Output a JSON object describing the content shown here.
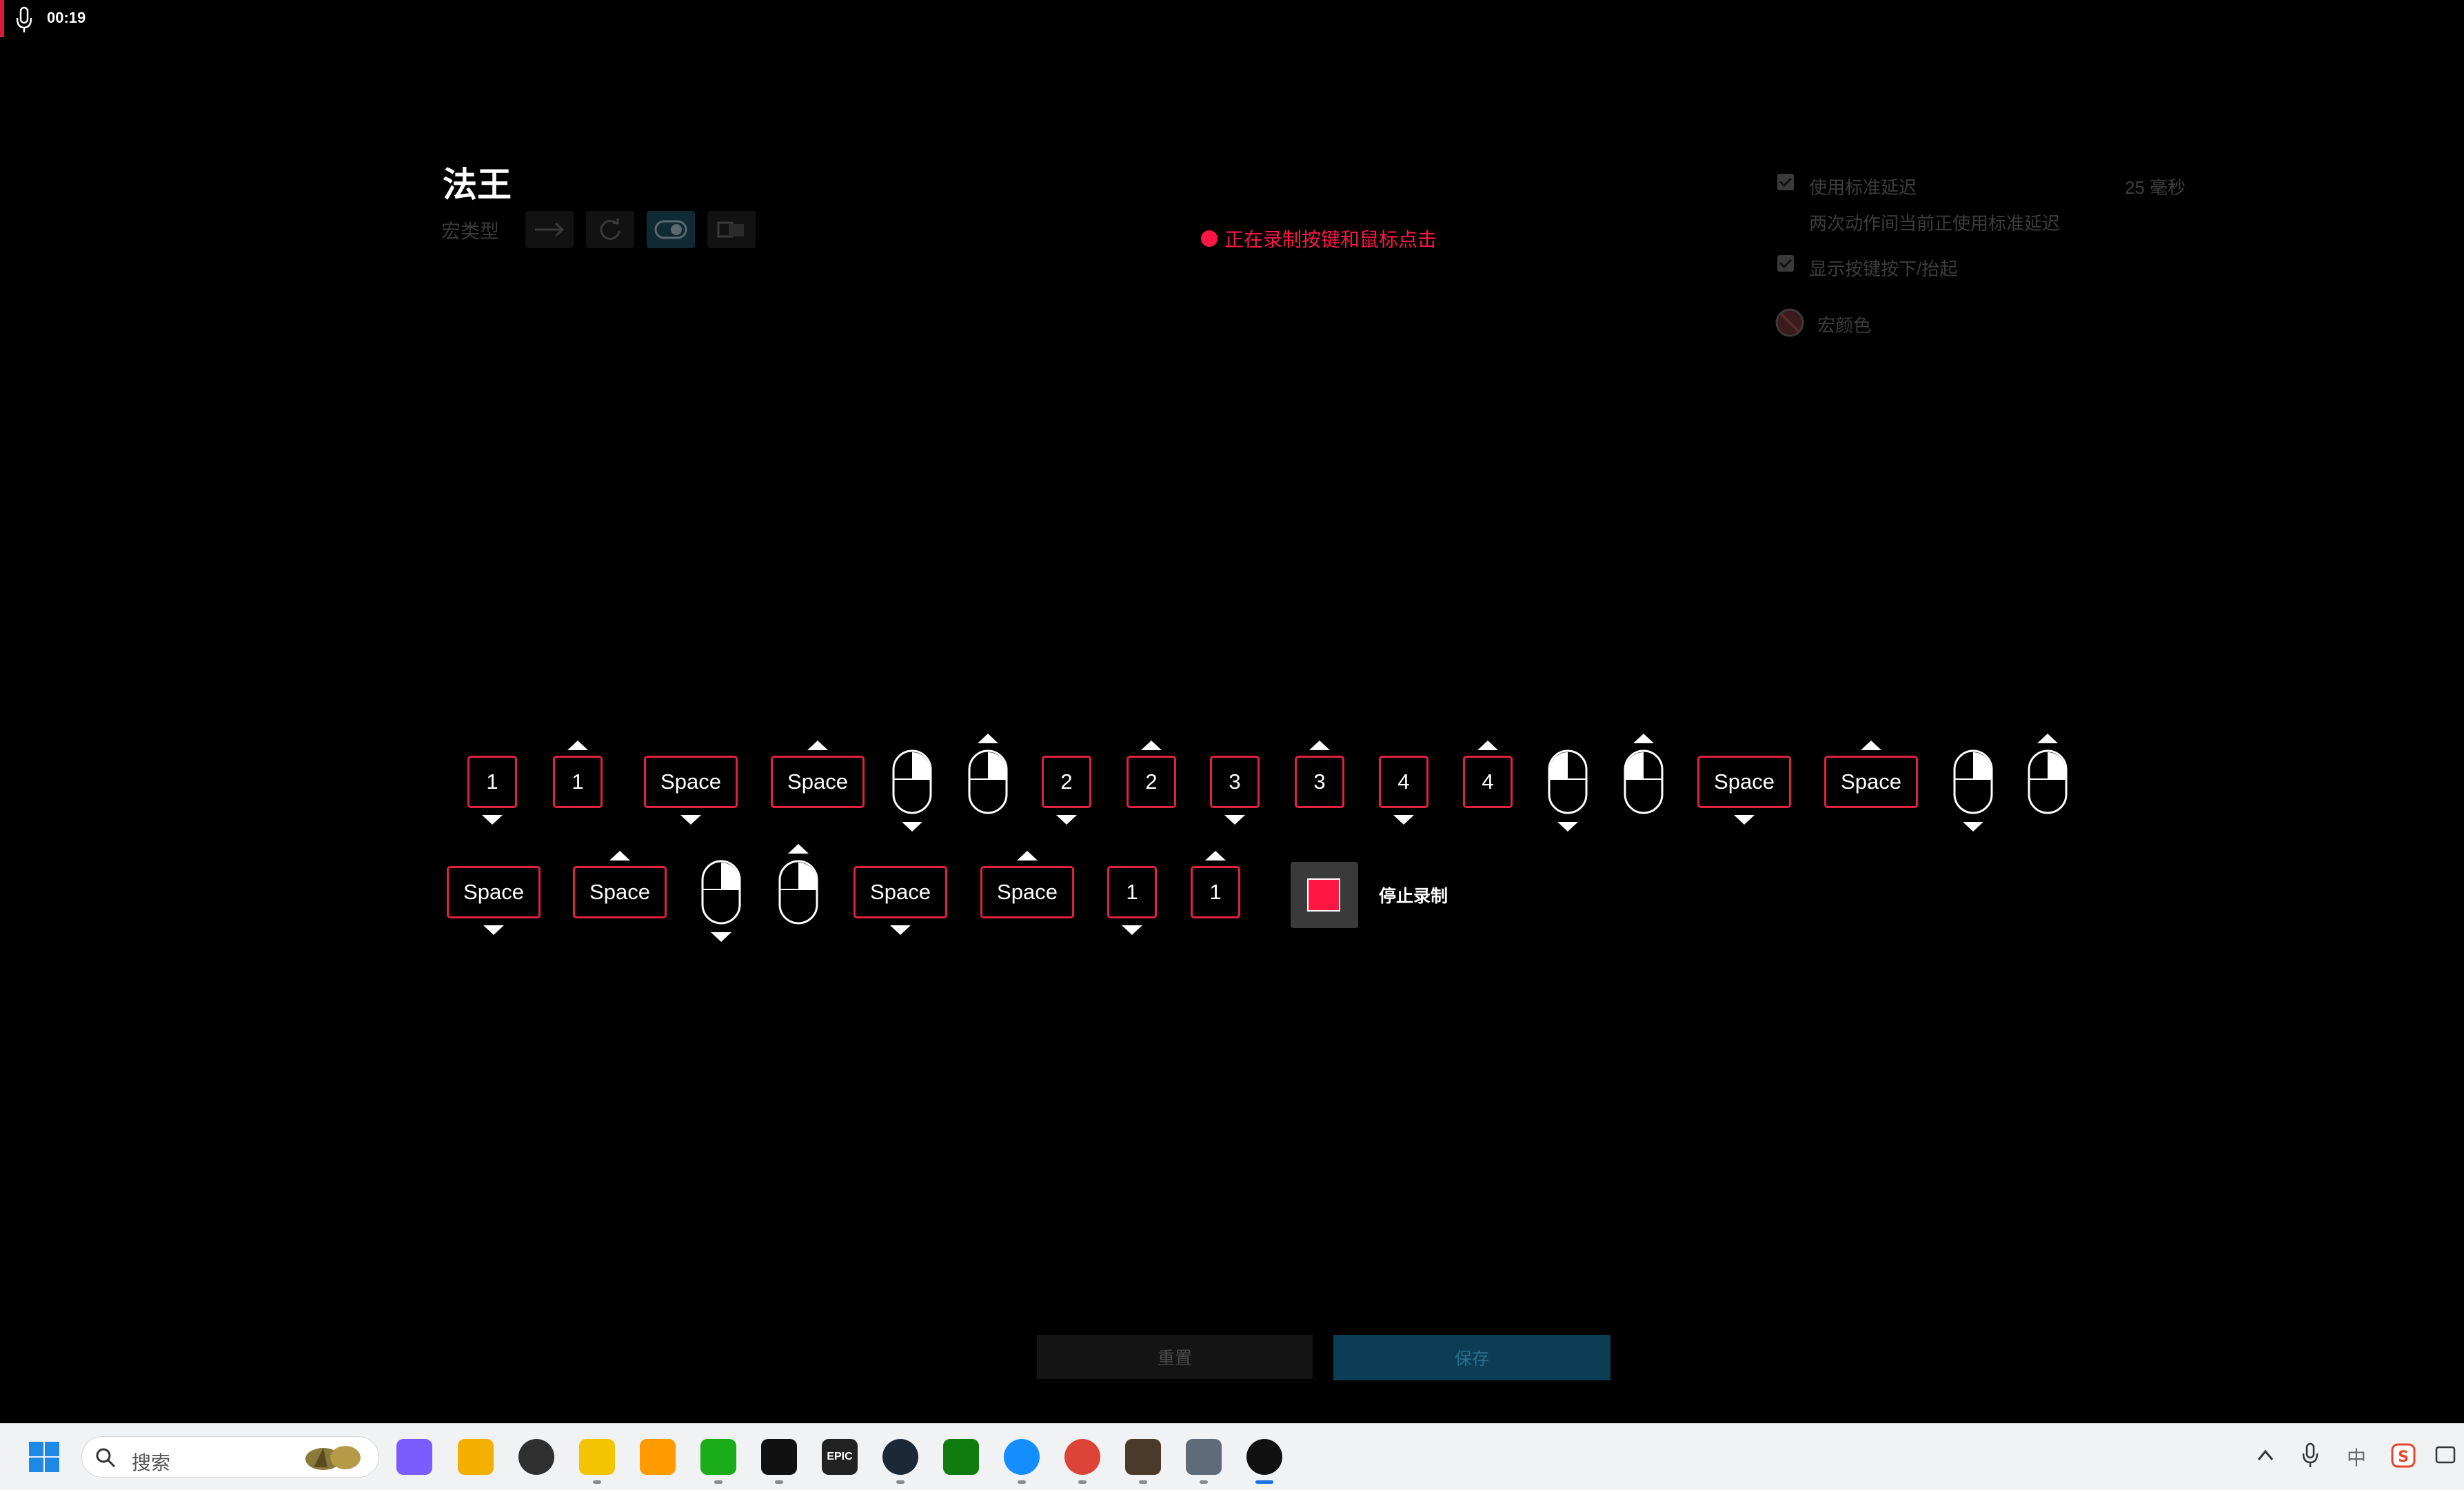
{
  "recording_indicator": {
    "time": "00:19",
    "icon": "microphone-icon"
  },
  "header": {
    "title": "法王",
    "macro_type_label": "宏类型",
    "macro_type_icons": [
      "arrow-right-icon",
      "repeat-icon",
      "toggle-icon",
      "hold-icon"
    ]
  },
  "status": {
    "text": "正在录制按键和鼠标点击",
    "color": "#ff1744"
  },
  "settings": {
    "standard_delay_label": "使用标准延迟",
    "standard_delay_value": "25 毫秒",
    "standard_delay_desc": "两次动作间当前正使用标准延迟",
    "show_keys_label": "显示按键按下/抬起",
    "macro_color_label": "宏颜色"
  },
  "sequence_row1": [
    {
      "type": "key",
      "label": "1",
      "dir": "down"
    },
    {
      "type": "key",
      "label": "1",
      "dir": "up"
    },
    {
      "type": "key",
      "label": "Space",
      "dir": "down"
    },
    {
      "type": "key",
      "label": "Space",
      "dir": "up"
    },
    {
      "type": "mouse",
      "button": "right",
      "dir": "down"
    },
    {
      "type": "mouse",
      "button": "right",
      "dir": "up"
    },
    {
      "type": "key",
      "label": "2",
      "dir": "down"
    },
    {
      "type": "key",
      "label": "2",
      "dir": "up"
    },
    {
      "type": "key",
      "label": "3",
      "dir": "down"
    },
    {
      "type": "key",
      "label": "3",
      "dir": "up"
    },
    {
      "type": "key",
      "label": "4",
      "dir": "down"
    },
    {
      "type": "key",
      "label": "4",
      "dir": "up"
    },
    {
      "type": "mouse",
      "button": "left",
      "dir": "down"
    },
    {
      "type": "mouse",
      "button": "left",
      "dir": "up"
    },
    {
      "type": "key",
      "label": "Space",
      "dir": "down"
    },
    {
      "type": "key",
      "label": "Space",
      "dir": "up"
    },
    {
      "type": "mouse",
      "button": "right",
      "dir": "down"
    },
    {
      "type": "mouse",
      "button": "right",
      "dir": "up"
    }
  ],
  "sequence_row2": [
    {
      "type": "key",
      "label": "Space",
      "dir": "down"
    },
    {
      "type": "key",
      "label": "Space",
      "dir": "up"
    },
    {
      "type": "mouse",
      "button": "right",
      "dir": "down"
    },
    {
      "type": "mouse",
      "button": "right",
      "dir": "up"
    },
    {
      "type": "key",
      "label": "Space",
      "dir": "down"
    },
    {
      "type": "key",
      "label": "Space",
      "dir": "up"
    },
    {
      "type": "key",
      "label": "1",
      "dir": "down"
    },
    {
      "type": "key",
      "label": "1",
      "dir": "up"
    }
  ],
  "stop_label": "停止录制",
  "buttons": {
    "reset": "重置",
    "save": "保存"
  },
  "taskbar": {
    "search_placeholder": "搜索",
    "apps": [
      "copilot-icon",
      "file-explorer-icon",
      "ubisoft-icon",
      "qq-music-icon",
      "note-icon",
      "wechat-icon",
      "qq-icon",
      "epic-games-icon",
      "steam-icon",
      "xbox-icon",
      "battlenet-icon",
      "chrome-icon",
      "diablo-icon",
      "settings-icon",
      "logitech-g-hub-icon"
    ],
    "epic_label": "EPIC",
    "ime_label": "中",
    "tray_icons": [
      "chevron-up-icon",
      "microphone-icon",
      "ime-icon",
      "sogou-icon",
      "notification-icon"
    ]
  },
  "colors": {
    "accent_red": "#e0223f",
    "background": "#000000",
    "save_bg": "#0b3d55"
  }
}
